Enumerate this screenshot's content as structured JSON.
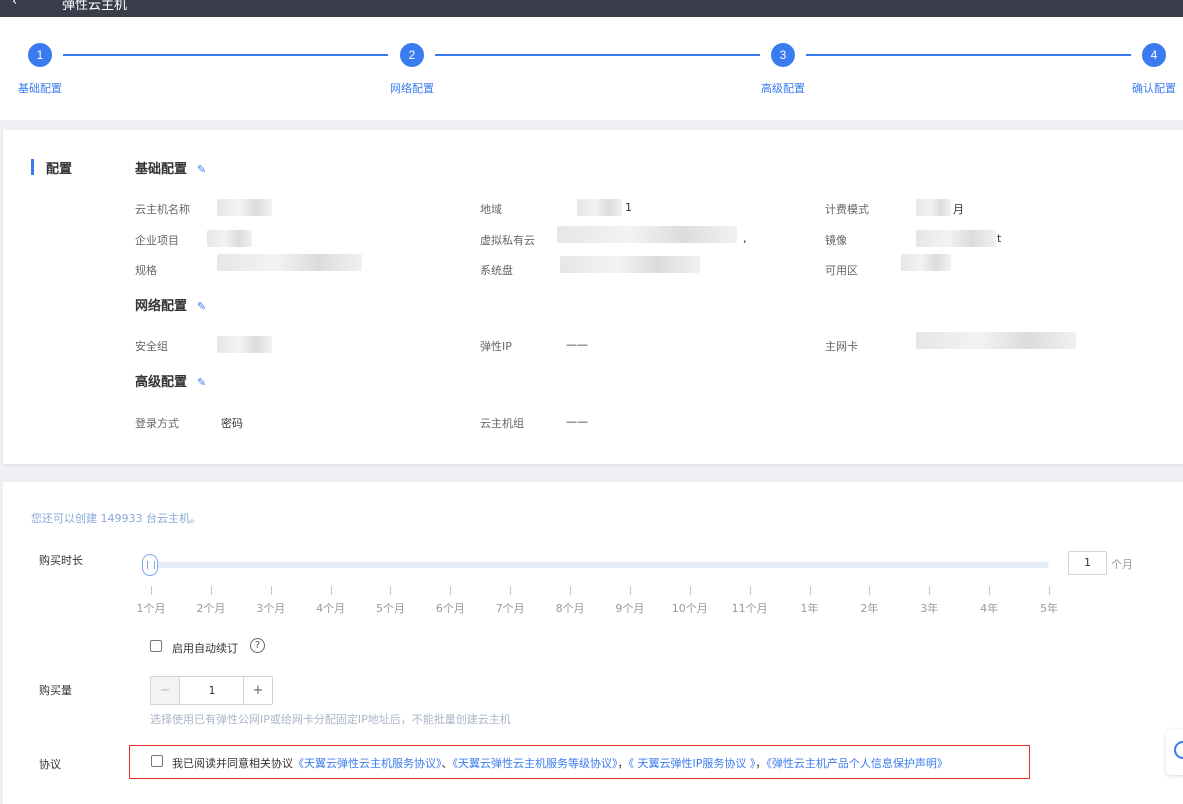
{
  "header": {
    "back_icon": "back-arrow-icon",
    "back_glyph": "‹",
    "title": "弹性云主机"
  },
  "steps": [
    {
      "num": "1",
      "label": "基础配置"
    },
    {
      "num": "2",
      "label": "网络配置"
    },
    {
      "num": "3",
      "label": "高级配置"
    },
    {
      "num": "4",
      "label": "确认配置"
    }
  ],
  "config": {
    "section_title": "配置",
    "edit_icon": "edit-pencil-icon",
    "edit_glyph": "✎",
    "basic": {
      "title": "基础配置",
      "fields": {
        "name": "云主机名称",
        "region": "地域",
        "billing": "计费模式",
        "project": "企业项目",
        "vpc": "虚拟私有云",
        "image": "镜像",
        "spec": "规格",
        "disk": "系统盘",
        "zone": "可用区"
      },
      "partial": {
        "region_tail": "1",
        "billing_tail": "月",
        "vpc_tail": ",",
        "image_tail": "t"
      }
    },
    "network": {
      "title": "网络配置",
      "fields": {
        "security_group": "安全组",
        "eip": "弹性IP",
        "nic": "主网卡"
      },
      "eip_value": "——"
    },
    "advanced": {
      "title": "高级配置",
      "fields": {
        "login": "登录方式",
        "group": "云主机组"
      },
      "login_value": "密码",
      "group_value": "——"
    }
  },
  "purchase": {
    "hint": "您还可以创建 149933 台云主机。",
    "duration_label": "购买时长",
    "ticks": [
      "1个月",
      "2个月",
      "3个月",
      "4个月",
      "5个月",
      "6个月",
      "7个月",
      "8个月",
      "9个月",
      "10个月",
      "11个月",
      "1年",
      "2年",
      "3年",
      "4年",
      "5年"
    ],
    "duration_value": "1",
    "duration_unit": "个月",
    "auto_renew_label": "启用自动续订",
    "help_glyph": "?",
    "quantity_label": "购买量",
    "quantity_value": "1",
    "minus_glyph": "−",
    "plus_glyph": "+",
    "quantity_hint": "选择使用已有弹性公网IP或给网卡分配固定IP地址后，不能批量创建云主机",
    "agreement_label": "协议",
    "agreement_prefix": "我已阅读并同意相关协议",
    "agreements": [
      "《天翼云弹性云主机服务协议》",
      "《天翼云弹性云主机服务等级协议》",
      "《 天翼云弹性IP服务协议 》",
      "《弹性云主机产品个人信息保护声明》"
    ],
    "sep1": "、",
    "sep2": "，",
    "sep3": "，"
  },
  "colors": {
    "accent": "#3a7bf0",
    "header_bg": "#3a3e4b",
    "alert_border": "#e0302c"
  }
}
